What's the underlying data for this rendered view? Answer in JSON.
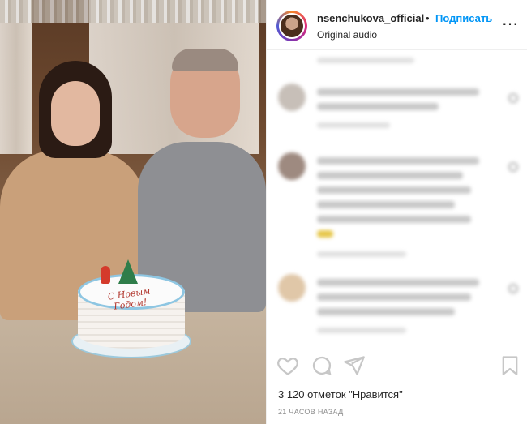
{
  "header": {
    "username": "nsenchukova_official",
    "separator": "•",
    "follow_label": "Подписать",
    "audio_label": "Original audio",
    "more_glyph": "⋯"
  },
  "media": {
    "cake_text_line1": "С Новым",
    "cake_text_line2": "Годом!"
  },
  "actions": {
    "icons": [
      "heart-icon",
      "comment-icon",
      "share-icon",
      "bookmark-icon"
    ]
  },
  "likes_text": "3 120 отметок \"Нравится\"",
  "timestamp": "21 ЧАСОВ НАЗАД",
  "colors": {
    "accent": "#0095f6",
    "text": "#262626",
    "muted": "#8e8e8e"
  }
}
